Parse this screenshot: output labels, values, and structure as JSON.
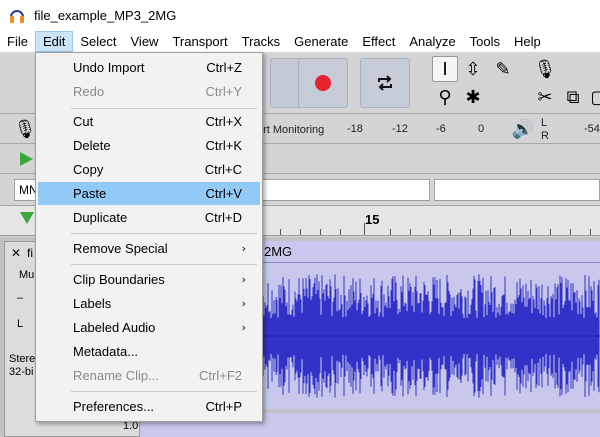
{
  "window": {
    "title": "file_example_MP3_2MG"
  },
  "menubar": [
    "File",
    "Edit",
    "Select",
    "View",
    "Transport",
    "Tracks",
    "Generate",
    "Effect",
    "Analyze",
    "Tools",
    "Help"
  ],
  "edit_menu": {
    "items": [
      {
        "label": "Undo Import",
        "shortcut": "Ctrl+Z",
        "enabled": true
      },
      {
        "label": "Redo",
        "shortcut": "Ctrl+Y",
        "enabled": false
      },
      {
        "label": "Cut",
        "shortcut": "Ctrl+X",
        "enabled": true
      },
      {
        "label": "Delete",
        "shortcut": "Ctrl+K",
        "enabled": true
      },
      {
        "label": "Copy",
        "shortcut": "Ctrl+C",
        "enabled": true
      },
      {
        "label": "Paste",
        "shortcut": "Ctrl+V",
        "enabled": true,
        "highlighted": true
      },
      {
        "label": "Duplicate",
        "shortcut": "Ctrl+D",
        "enabled": true
      },
      {
        "label": "Remove Special",
        "submenu": true
      },
      {
        "label": "Clip Boundaries",
        "submenu": true
      },
      {
        "label": "Labels",
        "submenu": true
      },
      {
        "label": "Labeled Audio",
        "submenu": true
      },
      {
        "label": "Metadata...",
        "enabled": true
      },
      {
        "label": "Rename Clip...",
        "shortcut": "Ctrl+F2",
        "enabled": false
      },
      {
        "label": "Preferences...",
        "shortcut": "Ctrl+P",
        "enabled": true
      }
    ]
  },
  "meter": {
    "monitor_text": "art Monitoring",
    "ticks": [
      "-18",
      "-12",
      "-6",
      "0"
    ],
    "right_tick": "-54",
    "lr": [
      "L",
      "R"
    ]
  },
  "host_dropdown": "MN",
  "ruler": {
    "label": "15"
  },
  "track": {
    "close": "✕",
    "name_short": "fi",
    "name_tail": "2MG",
    "mute": "Mu",
    "l": "L",
    "info1": "Stere",
    "info2": "32-bi",
    "bottom_num": "1.0"
  },
  "colors": {
    "waveform": "#3232c8",
    "track_bg": "#c8c8ec",
    "highlight": "#91c9f7",
    "record": "#e8232f"
  }
}
